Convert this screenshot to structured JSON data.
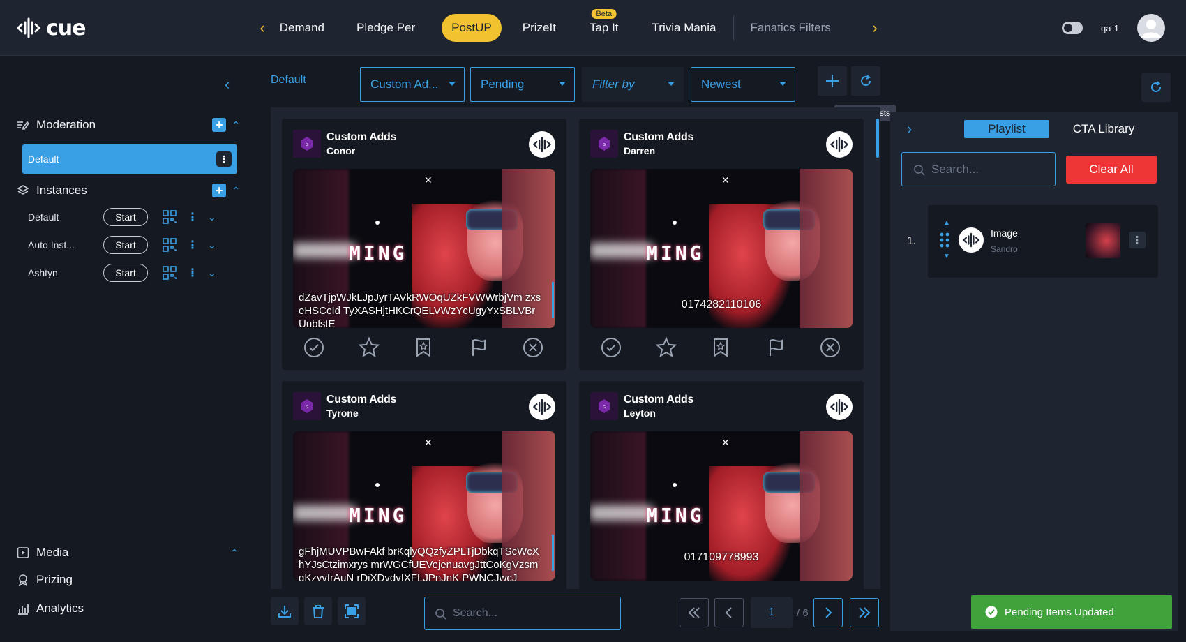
{
  "app": {
    "logo_text": "cue"
  },
  "nav": {
    "tabs": [
      {
        "label": "Demand"
      },
      {
        "label": "Pledge Per"
      },
      {
        "label": "PostUP"
      },
      {
        "label": "PrizeIt"
      },
      {
        "label": "Tap It",
        "badge": "Beta"
      },
      {
        "label": "Trivia Mania"
      },
      {
        "label": "Fanatics Filters"
      }
    ],
    "active_tab": "PostUP",
    "user": "qa-1"
  },
  "sidebar": {
    "moderation": {
      "label": "Moderation",
      "items": [
        {
          "label": "Default"
        }
      ]
    },
    "instances": {
      "label": "Instances",
      "items": [
        {
          "name": "Default",
          "start": "Start"
        },
        {
          "name": "Auto Inst...",
          "start": "Start"
        },
        {
          "name": "Ashtyn",
          "start": "Start"
        }
      ]
    },
    "bottom": [
      {
        "label": "Media"
      },
      {
        "label": "Prizing"
      },
      {
        "label": "Analytics"
      }
    ]
  },
  "main": {
    "breadcrumb": "Default",
    "filters": {
      "type": "Custom Ad...",
      "status": "Pending",
      "filter_by": "Filter by",
      "sort": "Newest"
    },
    "tooltip": "Update Posts",
    "cards": [
      {
        "title": "Custom Adds",
        "user": "Conor",
        "text": "dZavTjpWJkLJpJyrTAVkRWOqUZkFVWWrbjVm zxseHSCcId TyXASHjtHKCrQELVWzYcUgyYxSBLVBrUublstE"
      },
      {
        "title": "Custom Adds",
        "user": "Darren",
        "text": "0174282110106"
      },
      {
        "title": "Custom Adds",
        "user": "Tyrone",
        "text": "gFhjMUVPBwFAkf brKqlyQQzfyZPLTjDbkqTScWcXhYJsCtzimxrys mrWGCfUEVejenuavgJttCoKgVzsmqKzyvfrAuN rDjXDvdvIXFLJPnJnK PWNCJwcJ"
      },
      {
        "title": "Custom Adds",
        "user": "Leyton",
        "text": "017109778993"
      }
    ],
    "bottom_search_placeholder": "Search...",
    "pager": {
      "current": "1",
      "total": "/ 6"
    }
  },
  "right_panel": {
    "tabs": [
      "Playlist",
      "CTA Library"
    ],
    "search_placeholder": "Search...",
    "clear_label": "Clear All",
    "playlist": [
      {
        "num": "1.",
        "title": "Image",
        "sub": "Sandro"
      }
    ]
  },
  "toast": {
    "message": "Pending Items Updated"
  },
  "colors": {
    "accent": "#3aa0e6",
    "brand_yellow": "#f2c230",
    "danger": "#ee3636",
    "success": "#3fa23b"
  }
}
